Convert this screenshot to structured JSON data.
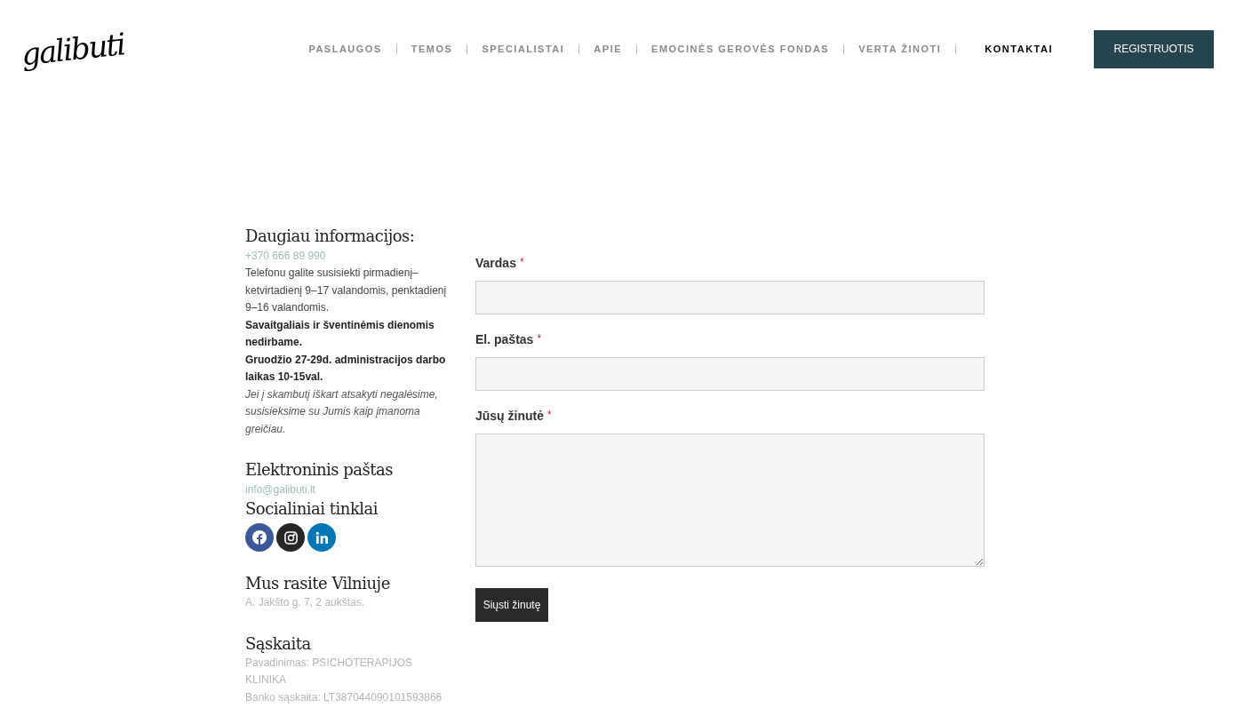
{
  "header": {
    "logo": "galibuti",
    "nav": [
      {
        "label": "PASLAUGOS",
        "selected": false
      },
      {
        "label": "TEMOS",
        "selected": false
      },
      {
        "label": "SPECIALISTAI",
        "selected": false
      },
      {
        "label": "APIE",
        "selected": false
      },
      {
        "label": "EMOCINĖS GEROVĖS FONDAS",
        "selected": false
      },
      {
        "label": "VERTA ŽINOTI",
        "selected": false
      },
      {
        "label": "KONTAKTAI",
        "selected": true
      }
    ],
    "cta": "REGISTRUOTIS"
  },
  "info": [
    {
      "heading": "Daugiau informacijos:",
      "lines": [
        {
          "kind": "link",
          "text": "+370 666 89 990"
        },
        {
          "kind": "normal",
          "text": "Telefonu galite susisiekti pirmadienį–ketvirtadienį 9–17 valandomis, penktadienį 9–16 valandomis."
        },
        {
          "kind": "bold",
          "text": "Savaitgaliais ir šventinėmis dienomis nedirbame."
        },
        {
          "kind": "bold",
          "text": "Gruodžio 27-29d. administracijos darbo laikas 10-15val."
        },
        {
          "kind": "italic",
          "text": "Jei į skambutį iškart atsakyti negalėsime, susisieksime su Jumis kaip įmanoma greičiau."
        }
      ]
    },
    {
      "heading": "Elektroninis paštas",
      "lines": [
        {
          "kind": "link",
          "text": "info@galibuti.lt"
        }
      ]
    },
    {
      "heading": "Socialiniai tinklai",
      "social": [
        {
          "kind": "facebook"
        },
        {
          "kind": "instagram"
        },
        {
          "kind": "linkedin"
        }
      ]
    },
    {
      "heading": "Mus rasite Vilniuje",
      "lines": [
        {
          "kind": "muted",
          "text": "A. Jakšto g. 7, 2 aukštas."
        }
      ]
    },
    {
      "heading": "Sąskaita",
      "lines": [
        {
          "kind": "muted",
          "text": "Pavadinimas: PSICHOTERAPIJOS KLINIKA"
        },
        {
          "kind": "muted",
          "text": "Banko sąskaita: LT387044090101593866"
        }
      ]
    }
  ],
  "form": {
    "fields": [
      {
        "label": "Vardas",
        "required_mark": "*",
        "kind": "input"
      },
      {
        "label": "El. paštas",
        "required_mark": "*",
        "kind": "input"
      },
      {
        "label": "Jūsų žinutė",
        "required_mark": "*",
        "kind": "textarea"
      }
    ],
    "submit": "Siųsti žinutę"
  }
}
